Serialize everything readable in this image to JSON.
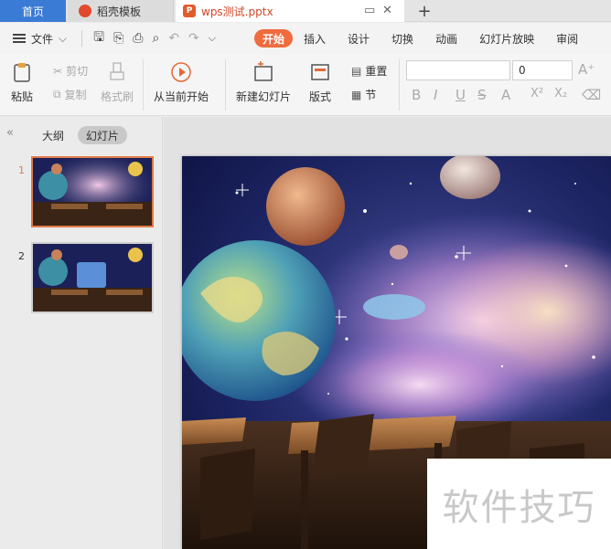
{
  "tabs": {
    "home": "首页",
    "templates": "稻壳模板",
    "document": "wps测试.pptx",
    "doc_icon": "P"
  },
  "menu": {
    "file": "文件",
    "tabs": [
      "开始",
      "插入",
      "设计",
      "切换",
      "动画",
      "幻灯片放映",
      "审阅"
    ],
    "active_tab": "开始"
  },
  "ribbon": {
    "paste": "粘贴",
    "cut": "剪切",
    "copy": "复制",
    "format_painter": "格式刷",
    "from_current": "从当前开始",
    "new_slide": "新建幻灯片",
    "layout": "版式",
    "reset": "重置",
    "section": "节",
    "font_name": "",
    "font_size": "0",
    "format_buttons": [
      "B",
      "I",
      "U",
      "S",
      "A",
      "X²",
      "X₂"
    ]
  },
  "panel": {
    "outline_tab": "大纲",
    "slides_tab": "幻灯片",
    "slides": [
      {
        "number": "1",
        "selected": true
      },
      {
        "number": "2",
        "selected": false
      }
    ]
  },
  "watermark": "软件技巧",
  "colors": {
    "accent": "#f06b3e",
    "home_tab": "#3a7bd5",
    "selected_thumb": "#e07a4a"
  }
}
